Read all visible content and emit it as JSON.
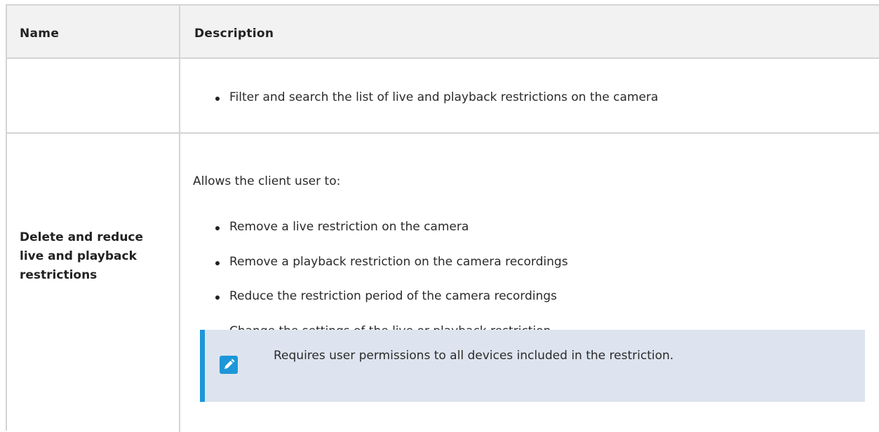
{
  "table": {
    "headers": {
      "name": "Name",
      "description": "Description"
    },
    "rows": [
      {
        "name": "",
        "bullets": [
          "Filter and search the list of live and playback restrictions on the camera"
        ]
      },
      {
        "name": "Delete and reduce live and playback restrictions",
        "intro": "Allows the client user to:",
        "bullets": [
          "Remove a live restriction on the camera",
          "Remove a playback restriction on the camera recordings",
          "Reduce the restriction period of the camera recordings",
          "Change the settings of the live or playback restriction"
        ],
        "note": {
          "icon": "pencil-icon",
          "text": "Requires user permissions to all devices included in the restriction."
        }
      }
    ]
  },
  "colors": {
    "header_bg": "#f2f2f2",
    "border": "#d4d4d4",
    "note_bg": "#dde4ef",
    "accent": "#1d97d9"
  }
}
